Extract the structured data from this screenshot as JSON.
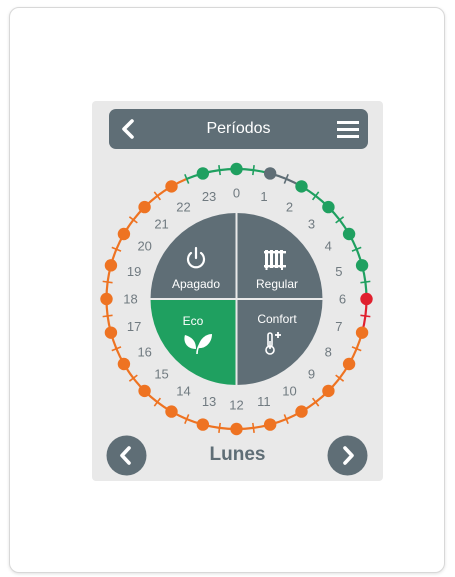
{
  "header": {
    "title": "Períodos"
  },
  "modes": [
    {
      "id": "apagado",
      "label": "Apagado",
      "color": "#5f6e76",
      "icon": "power-icon"
    },
    {
      "id": "regular",
      "label": "Regular",
      "color": "#5f6e76",
      "icon": "radiator-icon"
    },
    {
      "id": "eco",
      "label": "Eco",
      "color": "#1fa060",
      "icon": "leaf-icon"
    },
    {
      "id": "confort",
      "label": "Confort",
      "color": "#5f6e76",
      "icon": "thermometer-plus-icon"
    }
  ],
  "hours": [
    "0",
    "1",
    "2",
    "3",
    "4",
    "5",
    "6",
    "7",
    "8",
    "9",
    "10",
    "11",
    "12",
    "13",
    "14",
    "15",
    "16",
    "17",
    "18",
    "19",
    "20",
    "21",
    "22",
    "23"
  ],
  "half_hour_colors": {
    "green": "#1fa060",
    "gray": "#5f6e76",
    "red": "#e0202e",
    "orange": "#ee7322"
  },
  "schedule": [
    "green",
    "green",
    "gray",
    "gray",
    "green",
    "green",
    "green",
    "green",
    "green",
    "green",
    "green",
    "green",
    "red",
    "red",
    "orange",
    "orange",
    "orange",
    "orange",
    "orange",
    "orange",
    "orange",
    "orange",
    "orange",
    "orange",
    "orange",
    "orange",
    "orange",
    "orange",
    "orange",
    "orange",
    "orange",
    "orange",
    "orange",
    "orange",
    "orange",
    "orange",
    "orange",
    "orange",
    "orange",
    "orange",
    "orange",
    "orange",
    "orange",
    "orange",
    "orange",
    "green",
    "green",
    "green"
  ],
  "footer": {
    "day": "Lunes"
  }
}
